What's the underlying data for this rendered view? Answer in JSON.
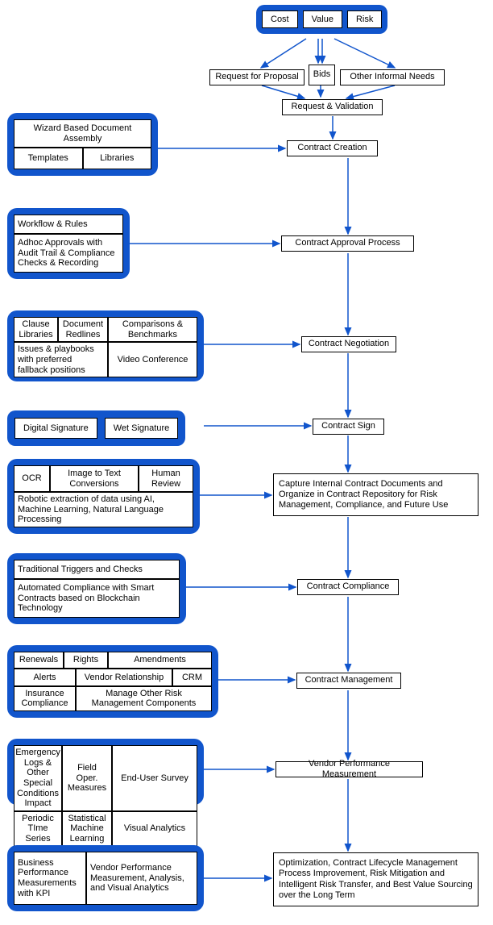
{
  "top": {
    "cost": "Cost",
    "value": "Value",
    "risk": "Risk"
  },
  "inputs": {
    "rfp": "Request for Proposal",
    "bids": "Bids",
    "other": "Other Informal Needs",
    "reqval": "Request & Validation"
  },
  "main": {
    "creation": "Contract Creation",
    "approval": "Contract Approval Process",
    "negotiation": "Contract Negotiation",
    "sign": "Contract Sign",
    "capture": "Capture Internal Contract Documents and Organize in Contract Repository for Risk Management, Compliance, and Future Use",
    "compliance": "Contract Compliance",
    "management": "Contract Management",
    "vendor": "Vendor Performance Measurement",
    "optimization": "Optimization, Contract Lifecycle Management Process Improvement, Risk Mitigation and Intelligent Risk Transfer, and Best Value Sourcing over the Long Term"
  },
  "panel_creation": {
    "header": "Wizard Based Document Assembly",
    "templates": "Templates",
    "libraries": "Libraries"
  },
  "panel_approval": {
    "row1": "Workflow & Rules",
    "row2": "Adhoc Approvals with Audit Trail & Compliance Checks & Recording"
  },
  "panel_negotiation": {
    "clause": "Clause Libraries",
    "redlines": "Document Redlines",
    "compare": "Comparisons & Benchmarks",
    "issues": "Issues & playbooks with preferred fallback positions",
    "video": "Video Conference"
  },
  "panel_sign": {
    "digital": "Digital Signature",
    "wet": "Wet Signature"
  },
  "panel_capture": {
    "ocr": "OCR",
    "image": "Image to Text Conversions",
    "human": "Human Review",
    "robotic": "Robotic extraction of data using AI, Machine Learning, Natural Language Processing"
  },
  "panel_compliance": {
    "traditional": "Traditional Triggers and Checks",
    "automated": "Automated Compliance with Smart Contracts based on Blockchain Technology"
  },
  "panel_management": {
    "renewals": "Renewals",
    "rights": "Rights",
    "amendments": "Amendments",
    "alerts": "Alerts",
    "vendor": "Vendor Relationship",
    "crm": "CRM",
    "insurance": "Insurance Compliance",
    "manage": "Manage Other Risk Management Components"
  },
  "panel_vendor": {
    "field": "Field Oper. Measures",
    "enduser": "End-User Survey",
    "emergency": "Emergency Logs & Other Special Conditions Impact",
    "periodic": "Periodic TIme Series",
    "statistical": "Statistical Machine Learning",
    "visual": "Visual Analytics"
  },
  "panel_optimization": {
    "business": "Business Performance Measurements with KPI",
    "vendor": "Vendor Performance Measurement, Analysis, and Visual Analytics"
  }
}
